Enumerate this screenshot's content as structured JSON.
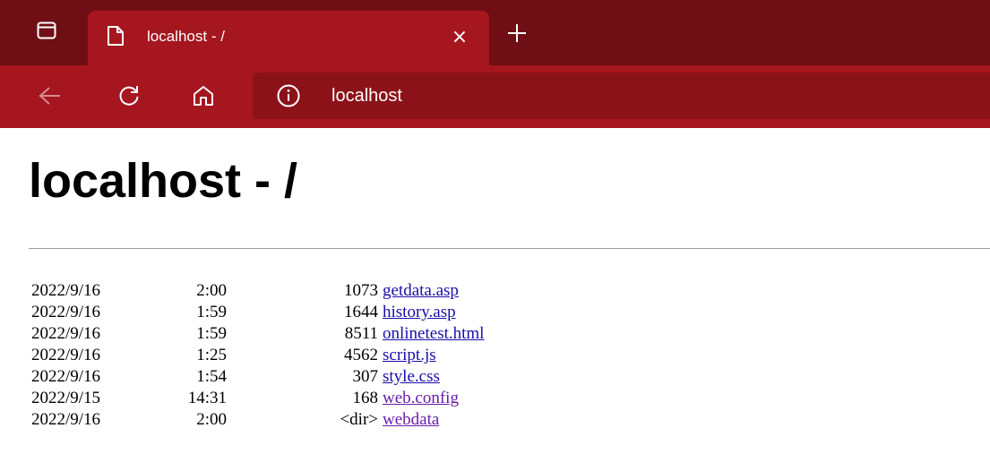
{
  "browser": {
    "tab": {
      "title": "localhost - /",
      "close_glyph": "×"
    },
    "address": "localhost",
    "colors": {
      "titlebar": "#6f0f15",
      "tab_active": "#a5161f",
      "toolbar": "#a5161f",
      "addressbar": "#8b1219"
    },
    "icons": [
      "tab-actions-icon",
      "page-icon",
      "close-icon",
      "plus-icon",
      "back-arrow-icon",
      "refresh-icon",
      "home-icon",
      "info-icon"
    ]
  },
  "page": {
    "heading": "localhost - /",
    "entries": [
      {
        "date": "2022/9/16",
        "time": "2:00",
        "size": "1073",
        "name": "getdata.asp"
      },
      {
        "date": "2022/9/16",
        "time": "1:59",
        "size": "1644",
        "name": "history.asp"
      },
      {
        "date": "2022/9/16",
        "time": "1:59",
        "size": "8511",
        "name": "onlinetest.html"
      },
      {
        "date": "2022/9/16",
        "time": "1:25",
        "size": "4562",
        "name": "script.js"
      },
      {
        "date": "2022/9/16",
        "time": "1:54",
        "size": "307",
        "name": "style.css"
      },
      {
        "date": "2022/9/15",
        "time": "14:31",
        "size": "168",
        "name": "web.config"
      },
      {
        "date": "2022/9/16",
        "time": "2:00",
        "size": "<dir>",
        "name": "webdata"
      }
    ],
    "colors": {
      "link": "#1a0dab",
      "visited_link": "#681da8"
    }
  }
}
